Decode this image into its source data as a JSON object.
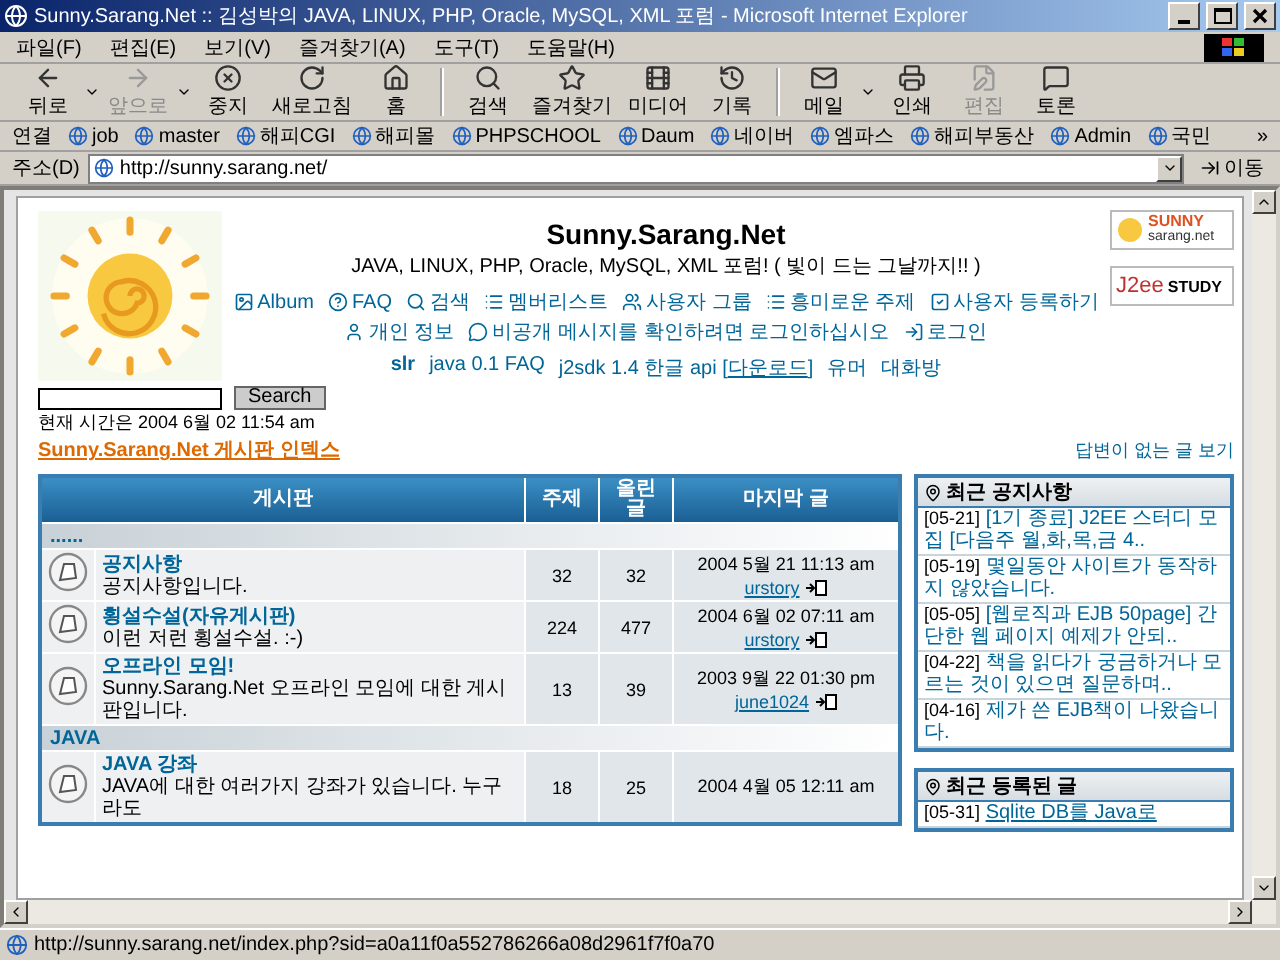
{
  "window": {
    "title": "Sunny.Sarang.Net :: 김성박의 JAVA, LINUX, PHP, Oracle, MySQL, XML 포럼 - Microsoft Internet Explorer"
  },
  "menu": [
    "파일(F)",
    "편집(E)",
    "보기(V)",
    "즐겨찾기(A)",
    "도구(T)",
    "도움말(H)"
  ],
  "toolbar": {
    "buttons": [
      {
        "kind": "back",
        "label": "뒤로",
        "disabled": false,
        "dropdown": true
      },
      {
        "kind": "forward",
        "label": "앞으로",
        "disabled": true,
        "dropdown": true
      },
      {
        "kind": "stop",
        "label": "중지",
        "disabled": false,
        "dropdown": false
      },
      {
        "kind": "refresh",
        "label": "새로고침",
        "disabled": false,
        "dropdown": false
      },
      {
        "kind": "home",
        "label": "홈",
        "disabled": false,
        "dropdown": false
      },
      {
        "kind": "search",
        "label": "검색",
        "disabled": false,
        "dropdown": false
      },
      {
        "kind": "favorites",
        "label": "즐겨찾기",
        "disabled": false,
        "dropdown": false
      },
      {
        "kind": "media",
        "label": "미디어",
        "disabled": false,
        "dropdown": false
      },
      {
        "kind": "history",
        "label": "기록",
        "disabled": false,
        "dropdown": false
      },
      {
        "kind": "mail",
        "label": "메일",
        "disabled": false,
        "dropdown": true
      },
      {
        "kind": "print",
        "label": "인쇄",
        "disabled": false,
        "dropdown": false
      },
      {
        "kind": "edit",
        "label": "편집",
        "disabled": true,
        "dropdown": false
      },
      {
        "kind": "discuss",
        "label": "토론",
        "disabled": false,
        "dropdown": false
      }
    ]
  },
  "links": {
    "label": "연결",
    "items": [
      "job",
      "master",
      "해피CGI",
      "해피몰",
      "PHPSCHOOL",
      "Daum",
      "네이버",
      "엠파스",
      "해피부동산",
      "Admin",
      "국민"
    ],
    "more": "»"
  },
  "address": {
    "label": "주소(D)",
    "value": "http://sunny.sarang.net/",
    "go": "이동"
  },
  "page": {
    "site_title": "Sunny.Sarang.Net",
    "tagline": "JAVA, LINUX, PHP, Oracle, MySQL, XML 포럼! ( 빛이 드는 그날까지!! )",
    "nav": [
      [
        {
          "kind": "album",
          "label": "Album"
        },
        {
          "kind": "faq",
          "label": "FAQ"
        },
        {
          "kind": "search",
          "label": "검색"
        },
        {
          "kind": "list",
          "label": "멤버리스트"
        },
        {
          "kind": "group",
          "label": "사용자 그룹"
        },
        {
          "kind": "list",
          "label": "흥미로운 주제"
        },
        {
          "kind": "check",
          "label": "사용자 등록하기"
        }
      ],
      [
        {
          "kind": "profile",
          "label": "개인 정보"
        },
        {
          "kind": "message",
          "label": "비공개 메시지를 확인하려면 로그인하십시오"
        },
        {
          "kind": "login",
          "label": "로그인"
        }
      ]
    ],
    "extra_links": [
      {
        "text": "slr",
        "bold": true
      },
      {
        "text": "java 0.1 FAQ",
        "bold": false
      },
      {
        "text": "j2sdk 1.4 한글 api [",
        "link": "다운로드",
        "suffix": "]",
        "bold": false
      },
      {
        "text": "유머",
        "bold": false
      },
      {
        "text": "대화방",
        "bold": false
      }
    ],
    "side_logos": [
      {
        "kind": "sunny",
        "text": "SUNNY",
        "sub": "sarang.net"
      },
      {
        "kind": "j2ee",
        "text": "J2ee",
        "sub": "STUDY"
      }
    ],
    "search_button": "Search",
    "current_time": "현재 시간은 2004 6월 02 11:54 am",
    "index_link": "Sunny.Sarang.Net 게시판 인덱스",
    "unanswered_link": "답변이 없는 글 보기"
  },
  "table": {
    "columns": [
      "게시판",
      "주제",
      "올린 글",
      "마지막 글"
    ],
    "categories": [
      {
        "name": "......",
        "forums": [
          {
            "name": "공지사항",
            "description": "공지사항입니다.",
            "topics": "32",
            "posts": "32",
            "last_date": "2004 5월 21 11:13 am",
            "last_user": "urstory"
          },
          {
            "name": "횡설수설(자유게시판)",
            "description": "이런 저런 횡설수설. :-)",
            "topics": "224",
            "posts": "477",
            "last_date": "2004 6월 02 07:11 am",
            "last_user": "urstory"
          },
          {
            "name": "오프라인 모임!",
            "description": "Sunny.Sarang.Net 오프라인 모임에 대한 게시판입니다.",
            "topics": "13",
            "posts": "39",
            "last_date": "2003 9월 22 01:30 pm",
            "last_user": "june1024"
          }
        ]
      },
      {
        "name": "JAVA",
        "forums": [
          {
            "name": "JAVA 강좌",
            "description": "JAVA에 대한 여러가지 강좌가 있습니다. 누구라도",
            "topics": "18",
            "posts": "25",
            "last_date": "2004 4월 05 12:11 am"
          }
        ]
      }
    ]
  },
  "sidebar": [
    {
      "title": "최근 공지사항",
      "items": [
        {
          "date": "[05-21]",
          "text": "[1기 종료] J2EE 스터디 모집 [다음주 월,화,목,금 4..",
          "underline": false
        },
        {
          "date": "[05-19]",
          "text": "몇일동안 사이트가 동작하지 않았습니다.",
          "underline": false
        },
        {
          "date": "[05-05]",
          "text": "[웹로직과 EJB 50page] 간단한 웹 페이지 예제가 안되..",
          "underline": false
        },
        {
          "date": "[04-22]",
          "text": "책을 읽다가 궁금하거나 모르는 것이 있으면 질문하며..",
          "underline": false
        },
        {
          "date": "[04-16]",
          "text": "제가 쓴 EJB책이 나왔습니다.",
          "underline": false
        }
      ]
    },
    {
      "title": "최근 등록된 글",
      "items": [
        {
          "date": "[05-31]",
          "text": "Sqlite DB를 Java로",
          "underline": true
        }
      ]
    }
  ],
  "status_bar": {
    "url": "http://sunny.sarang.net/index.php?sid=a0a11f0a552786266a08d2961f7f0a70"
  }
}
